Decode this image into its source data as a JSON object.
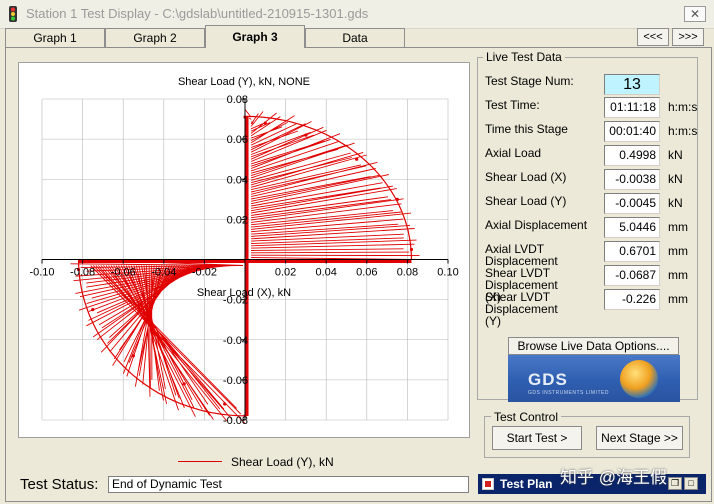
{
  "window": {
    "title": "Station 1 Test Display - C:\\gdslab\\untitled-210915-1301.gds",
    "close_label": "✕"
  },
  "tabs": [
    {
      "label": "Graph 1"
    },
    {
      "label": "Graph 2"
    },
    {
      "label": "Graph 3",
      "active": true
    },
    {
      "label": "Data"
    }
  ],
  "tab_nav": {
    "prev": "<<<",
    "next": ">>>"
  },
  "chart_data": {
    "type": "line",
    "title": "Shear Load (Y), kN, NONE",
    "xlabel": "Shear Load (X), kN",
    "ylabel": "",
    "xlim": [
      -0.1,
      0.1
    ],
    "ylim": [
      -0.08,
      0.08
    ],
    "x_ticks": [
      "-0.10",
      "-0.08",
      "-0.06",
      "-0.04",
      "-0.02",
      "0.02",
      "0.04",
      "0.06",
      "0.08",
      "0.10"
    ],
    "y_ticks": [
      "0.08",
      "0.06",
      "0.04",
      "0.02",
      "-0.02",
      "-0.04",
      "-0.06",
      "-0.08"
    ],
    "grid": true,
    "series": [
      {
        "name": "Shear Load (Y), kN",
        "color": "#e00000",
        "description_points": [
          [
            0.0,
            0.071
          ],
          [
            0.01,
            0.068
          ],
          [
            0.03,
            0.062
          ],
          [
            0.055,
            0.05
          ],
          [
            0.075,
            0.03
          ],
          [
            0.082,
            0.005
          ],
          [
            0.0,
            -0.078
          ],
          [
            -0.01,
            -0.072
          ],
          [
            -0.03,
            -0.062
          ],
          [
            -0.055,
            -0.048
          ],
          [
            -0.075,
            -0.025
          ],
          [
            -0.082,
            -0.005
          ]
        ]
      }
    ],
    "legend": "bottom-center"
  },
  "live": {
    "group_title": "Live Test Data",
    "rows": [
      {
        "label": "Test Stage Num:",
        "value": "13",
        "unit": ""
      },
      {
        "label": "Test Time:",
        "value": "01:11:18",
        "unit": "h:m:s"
      },
      {
        "label": "Time this Stage",
        "value": "00:01:40",
        "unit": "h:m:s"
      },
      {
        "label": "Axial Load",
        "value": "0.4998",
        "unit": "kN"
      },
      {
        "label": "Shear Load (X)",
        "value": "-0.0038",
        "unit": "kN"
      },
      {
        "label": "Shear Load (Y)",
        "value": "-0.0045",
        "unit": "kN"
      },
      {
        "label": "Axial Displacement",
        "value": "5.0446",
        "unit": "mm"
      },
      {
        "label": "Axial LVDT Displacement",
        "value": "0.6701",
        "unit": "mm"
      },
      {
        "label": "Shear LVDT Displacement (X)",
        "value": "-0.0687",
        "unit": "mm"
      },
      {
        "label": "Shear LVDT Displacement (Y)",
        "value": "-0.226",
        "unit": "mm"
      }
    ],
    "browse_label": "Browse Live Data Options....",
    "logo_text": "GDS",
    "logo_sub": "GDS INSTRUMENTS LIMITED"
  },
  "control": {
    "group_title": "Test Control",
    "start_label": "Start Test >",
    "next_label": "Next Stage >>"
  },
  "status": {
    "label": "Test Status:",
    "value": "End of Dynamic Test"
  },
  "taskbar": {
    "label": "Test Plan",
    "watermark": "知乎 @海王假"
  }
}
